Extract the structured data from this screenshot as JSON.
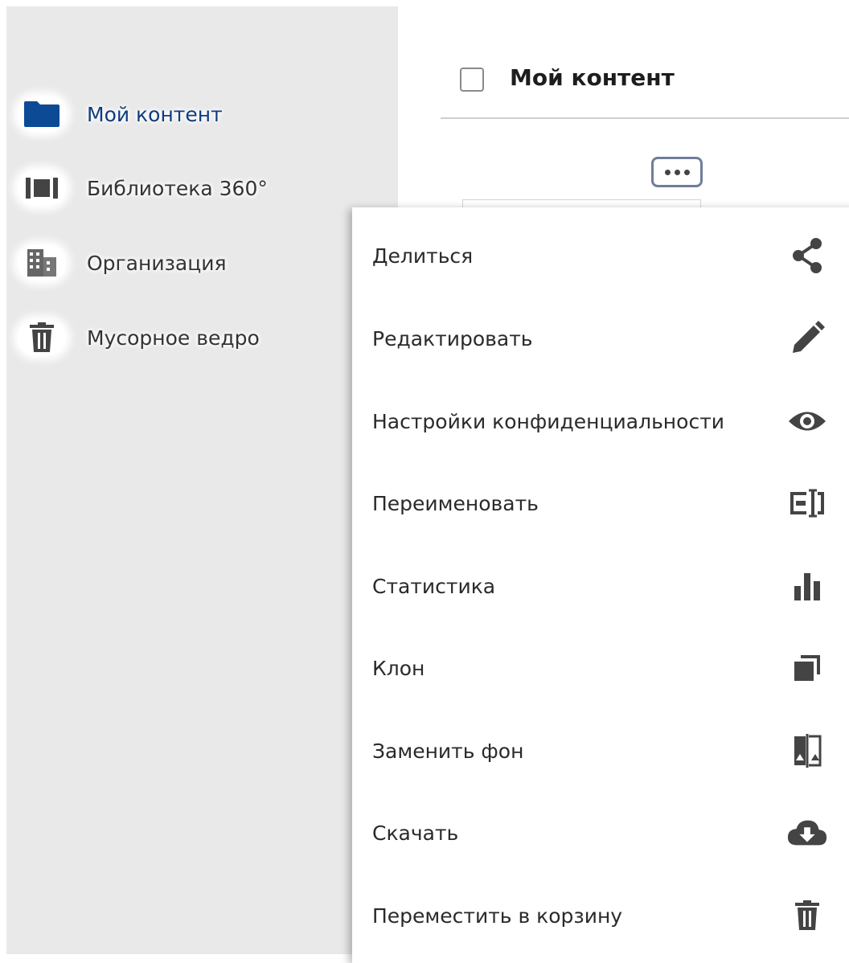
{
  "sidebar": {
    "items": [
      {
        "label": "Мой контент",
        "icon": "folder-icon",
        "active": true
      },
      {
        "label": "Библиотека 360°",
        "icon": "panorama-icon",
        "active": false
      },
      {
        "label": "Организация",
        "icon": "building-icon",
        "active": false
      },
      {
        "label": "Мусорное ведро",
        "icon": "trash-icon",
        "active": false
      }
    ]
  },
  "header": {
    "title": "Мой контент"
  },
  "menu": {
    "items": [
      {
        "label": "Делиться",
        "icon": "share-icon"
      },
      {
        "label": "Редактировать",
        "icon": "pencil-icon"
      },
      {
        "label": "Настройки конфиденциальности",
        "icon": "eye-icon"
      },
      {
        "label": "Переименовать",
        "icon": "rename-icon"
      },
      {
        "label": "Статистика",
        "icon": "bar-chart-icon"
      },
      {
        "label": "Клон",
        "icon": "clone-icon"
      },
      {
        "label": "Заменить фон",
        "icon": "swap-background-icon"
      },
      {
        "label": "Скачать",
        "icon": "cloud-download-icon"
      },
      {
        "label": "Переместить в корзину",
        "icon": "trash-icon"
      }
    ]
  },
  "colors": {
    "sidebar_bg": "#e9e9e9",
    "active_nav": "#0f3c7f",
    "folder_icon": "#0d4a96",
    "icon_gray": "#444444",
    "more_button_border": "#6f7e99"
  }
}
